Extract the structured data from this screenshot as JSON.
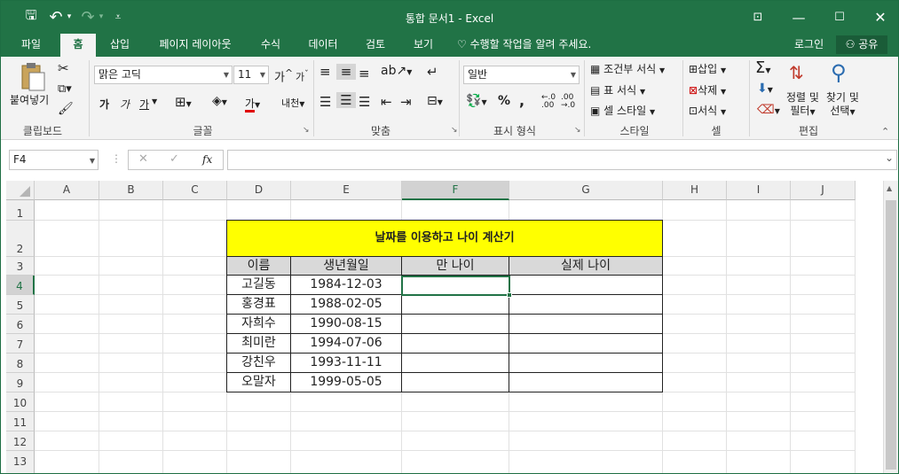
{
  "window": {
    "title": "통합 문서1 - Excel",
    "controls": {
      "ribbon_options": "⊡",
      "minimize": "—",
      "maximize": "☐",
      "close": "✕"
    }
  },
  "qat": {
    "save_icon": "🖫",
    "undo_icon": "↶",
    "undo_dd": "▾",
    "redo_icon": "↷",
    "redo_dd": "▾",
    "customize_icon": "⩡"
  },
  "tabs": [
    "파일",
    "홈",
    "삽입",
    "페이지 레이아웃",
    "수식",
    "데이터",
    "검토",
    "보기"
  ],
  "tell_me": "수행할 작업을 알려 주세요.",
  "account": {
    "login": "로그인",
    "share": "공유"
  },
  "ribbon": {
    "clipboard": {
      "paste": "붙여넣기",
      "label": "클립보드"
    },
    "font": {
      "name": "맑은 고딕",
      "size": "11",
      "grow": "가",
      "shrink": "가",
      "bold": "가",
      "italic": "가",
      "underline": "가",
      "font_color": "가",
      "phonetic": "내천",
      "label": "글꼴"
    },
    "alignment": {
      "label": "맞춤"
    },
    "number": {
      "format": "일반",
      "percent": "%",
      "comma": ",",
      "label": "표시 형식"
    },
    "styles": {
      "conditional": "조건부 서식",
      "as_table": "표 서식",
      "cell_styles": "셀 스타일",
      "label": "스타일"
    },
    "cells": {
      "insert": "삽입",
      "delete": "삭제",
      "format": "서식",
      "label": "셀"
    },
    "editing": {
      "sum": "Σ",
      "sort_filter_1": "정렬 및",
      "sort_filter_2": "필터",
      "find_1": "찾기 및",
      "find_2": "선택",
      "label": "편집"
    }
  },
  "formula_bar": {
    "name_box": "F4",
    "cancel": "✕",
    "enter": "✓",
    "fx": "fx",
    "value": ""
  },
  "grid": {
    "columns": [
      "A",
      "B",
      "C",
      "D",
      "E",
      "F",
      "G",
      "H",
      "I",
      "J"
    ],
    "rows": [
      "1",
      "2",
      "3",
      "4",
      "5",
      "6",
      "7",
      "8",
      "9",
      "10",
      "11",
      "12",
      "13"
    ],
    "selected_cell": "F4"
  },
  "sheet": {
    "title": "날짜를 이용하고 나이 계산기",
    "title_fill": "#ffff00",
    "header_fill": "#d9d9d9",
    "headers": [
      "이름",
      "생년월일",
      "만 나이",
      "실제 나이"
    ],
    "rows": [
      {
        "name": "고길동",
        "birth": "1984-12-03"
      },
      {
        "name": "홍경표",
        "birth": "1988-02-05"
      },
      {
        "name": "자희수",
        "birth": "1990-08-15"
      },
      {
        "name": "최미란",
        "birth": "1994-07-06"
      },
      {
        "name": "강친우",
        "birth": "1993-11-11"
      },
      {
        "name": "오말자",
        "birth": "1999-05-05"
      }
    ]
  },
  "colors": {
    "accent": "#217346"
  }
}
